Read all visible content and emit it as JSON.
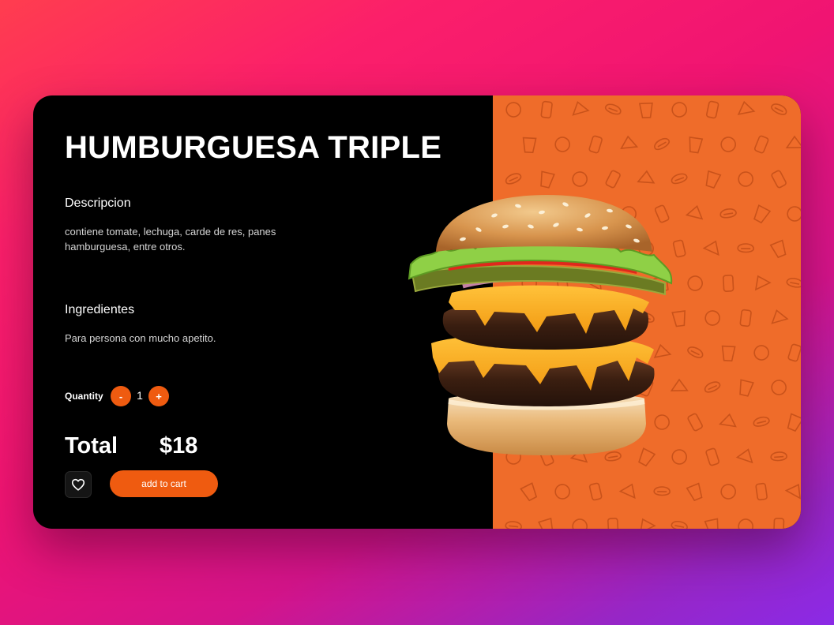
{
  "product": {
    "title": "HUMBURGUESA TRIPLE",
    "description_label": "Descripcion",
    "description_text": "contiene tomate, lechuga, carde de res, panes hamburguesa, entre otros.",
    "ingredients_label": "Ingredientes",
    "ingredients_text": "Para persona con mucho apetito.",
    "image_icon": "burger-image"
  },
  "quantity": {
    "label": "Quantity",
    "decrement_label": "-",
    "value": "1",
    "increment_label": "+"
  },
  "total": {
    "label": "Total",
    "price": "$18"
  },
  "actions": {
    "favorite_icon": "heart-icon",
    "add_to_cart_label": "add to cart"
  },
  "colors": {
    "accent": "#ef5b10",
    "pattern_panel": "#ef6c2a",
    "card_background": "#000000"
  }
}
